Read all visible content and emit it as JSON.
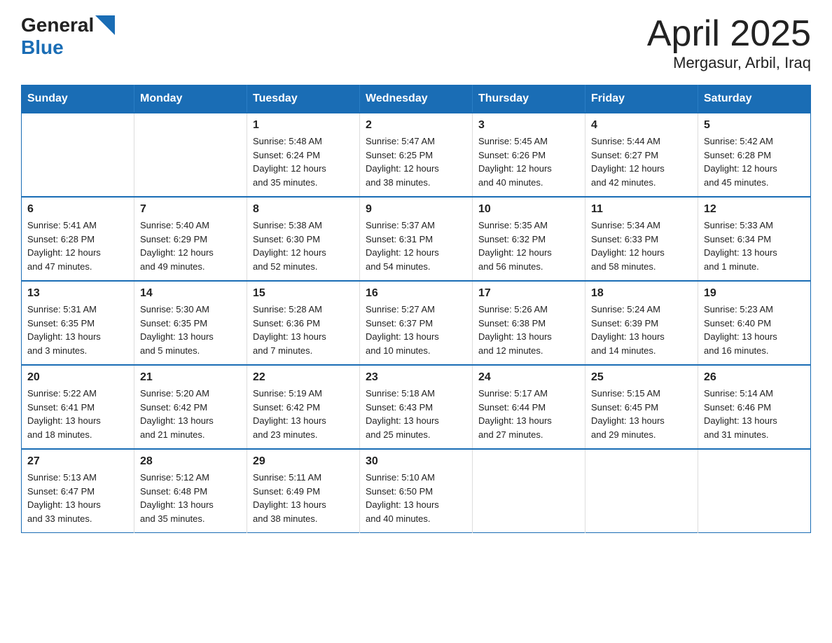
{
  "header": {
    "logo_general": "General",
    "logo_blue": "Blue",
    "title": "April 2025",
    "subtitle": "Mergasur, Arbil, Iraq"
  },
  "weekdays": [
    "Sunday",
    "Monday",
    "Tuesday",
    "Wednesday",
    "Thursday",
    "Friday",
    "Saturday"
  ],
  "weeks": [
    [
      {
        "day": "",
        "info": ""
      },
      {
        "day": "",
        "info": ""
      },
      {
        "day": "1",
        "info": "Sunrise: 5:48 AM\nSunset: 6:24 PM\nDaylight: 12 hours\nand 35 minutes."
      },
      {
        "day": "2",
        "info": "Sunrise: 5:47 AM\nSunset: 6:25 PM\nDaylight: 12 hours\nand 38 minutes."
      },
      {
        "day": "3",
        "info": "Sunrise: 5:45 AM\nSunset: 6:26 PM\nDaylight: 12 hours\nand 40 minutes."
      },
      {
        "day": "4",
        "info": "Sunrise: 5:44 AM\nSunset: 6:27 PM\nDaylight: 12 hours\nand 42 minutes."
      },
      {
        "day": "5",
        "info": "Sunrise: 5:42 AM\nSunset: 6:28 PM\nDaylight: 12 hours\nand 45 minutes."
      }
    ],
    [
      {
        "day": "6",
        "info": "Sunrise: 5:41 AM\nSunset: 6:28 PM\nDaylight: 12 hours\nand 47 minutes."
      },
      {
        "day": "7",
        "info": "Sunrise: 5:40 AM\nSunset: 6:29 PM\nDaylight: 12 hours\nand 49 minutes."
      },
      {
        "day": "8",
        "info": "Sunrise: 5:38 AM\nSunset: 6:30 PM\nDaylight: 12 hours\nand 52 minutes."
      },
      {
        "day": "9",
        "info": "Sunrise: 5:37 AM\nSunset: 6:31 PM\nDaylight: 12 hours\nand 54 minutes."
      },
      {
        "day": "10",
        "info": "Sunrise: 5:35 AM\nSunset: 6:32 PM\nDaylight: 12 hours\nand 56 minutes."
      },
      {
        "day": "11",
        "info": "Sunrise: 5:34 AM\nSunset: 6:33 PM\nDaylight: 12 hours\nand 58 minutes."
      },
      {
        "day": "12",
        "info": "Sunrise: 5:33 AM\nSunset: 6:34 PM\nDaylight: 13 hours\nand 1 minute."
      }
    ],
    [
      {
        "day": "13",
        "info": "Sunrise: 5:31 AM\nSunset: 6:35 PM\nDaylight: 13 hours\nand 3 minutes."
      },
      {
        "day": "14",
        "info": "Sunrise: 5:30 AM\nSunset: 6:35 PM\nDaylight: 13 hours\nand 5 minutes."
      },
      {
        "day": "15",
        "info": "Sunrise: 5:28 AM\nSunset: 6:36 PM\nDaylight: 13 hours\nand 7 minutes."
      },
      {
        "day": "16",
        "info": "Sunrise: 5:27 AM\nSunset: 6:37 PM\nDaylight: 13 hours\nand 10 minutes."
      },
      {
        "day": "17",
        "info": "Sunrise: 5:26 AM\nSunset: 6:38 PM\nDaylight: 13 hours\nand 12 minutes."
      },
      {
        "day": "18",
        "info": "Sunrise: 5:24 AM\nSunset: 6:39 PM\nDaylight: 13 hours\nand 14 minutes."
      },
      {
        "day": "19",
        "info": "Sunrise: 5:23 AM\nSunset: 6:40 PM\nDaylight: 13 hours\nand 16 minutes."
      }
    ],
    [
      {
        "day": "20",
        "info": "Sunrise: 5:22 AM\nSunset: 6:41 PM\nDaylight: 13 hours\nand 18 minutes."
      },
      {
        "day": "21",
        "info": "Sunrise: 5:20 AM\nSunset: 6:42 PM\nDaylight: 13 hours\nand 21 minutes."
      },
      {
        "day": "22",
        "info": "Sunrise: 5:19 AM\nSunset: 6:42 PM\nDaylight: 13 hours\nand 23 minutes."
      },
      {
        "day": "23",
        "info": "Sunrise: 5:18 AM\nSunset: 6:43 PM\nDaylight: 13 hours\nand 25 minutes."
      },
      {
        "day": "24",
        "info": "Sunrise: 5:17 AM\nSunset: 6:44 PM\nDaylight: 13 hours\nand 27 minutes."
      },
      {
        "day": "25",
        "info": "Sunrise: 5:15 AM\nSunset: 6:45 PM\nDaylight: 13 hours\nand 29 minutes."
      },
      {
        "day": "26",
        "info": "Sunrise: 5:14 AM\nSunset: 6:46 PM\nDaylight: 13 hours\nand 31 minutes."
      }
    ],
    [
      {
        "day": "27",
        "info": "Sunrise: 5:13 AM\nSunset: 6:47 PM\nDaylight: 13 hours\nand 33 minutes."
      },
      {
        "day": "28",
        "info": "Sunrise: 5:12 AM\nSunset: 6:48 PM\nDaylight: 13 hours\nand 35 minutes."
      },
      {
        "day": "29",
        "info": "Sunrise: 5:11 AM\nSunset: 6:49 PM\nDaylight: 13 hours\nand 38 minutes."
      },
      {
        "day": "30",
        "info": "Sunrise: 5:10 AM\nSunset: 6:50 PM\nDaylight: 13 hours\nand 40 minutes."
      },
      {
        "day": "",
        "info": ""
      },
      {
        "day": "",
        "info": ""
      },
      {
        "day": "",
        "info": ""
      }
    ]
  ]
}
